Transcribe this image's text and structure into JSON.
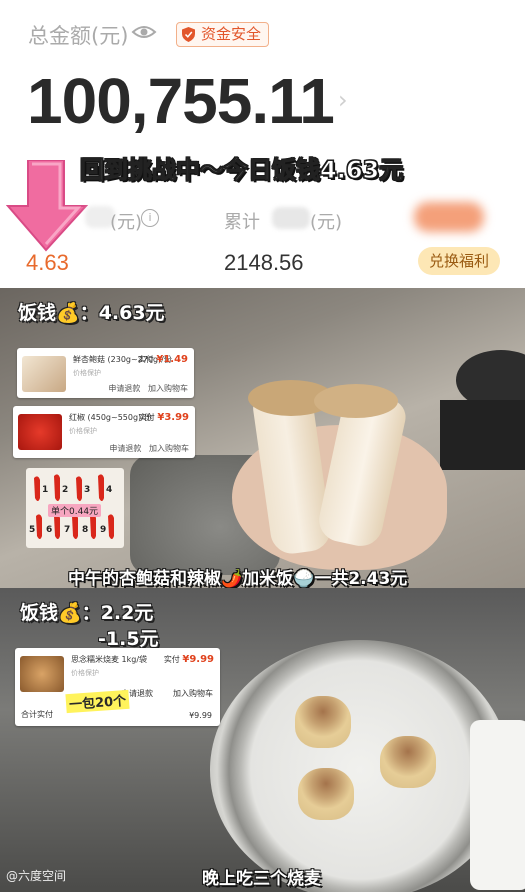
{
  "header": {
    "total_label": "总金额(元)",
    "badge": "资金安全",
    "amount": "100,755.11",
    "challenge_text": "回到挑战中～今日饭钱4.63元",
    "today_label": "(元)",
    "today_value": "4.63",
    "accum_label": "累计",
    "accum_unit": "(元)",
    "accum_value": "2148.56",
    "exchange_button": "兑换福利"
  },
  "panel1": {
    "cost_tag": "饭钱💰：4.63元",
    "cards": [
      {
        "name": "鲜杏鲍菇 (230g~270g)/份",
        "price_label": "实付",
        "price": "¥1.49",
        "sub": "价格保护",
        "actions": [
          "申请退款",
          "加入购物车"
        ]
      },
      {
        "name": "红椒 (450g~550g)/份",
        "price_label": "实付",
        "price": "¥3.99",
        "sub": "价格保护",
        "actions": [
          "申请退款",
          "加入购物车"
        ]
      }
    ],
    "pepper_caption": "单个0.44元",
    "pepper_numbers": [
      "1",
      "2",
      "3",
      "4",
      "5",
      "6",
      "7",
      "8",
      "9"
    ],
    "caption": "中午的杏鲍菇和辣椒🌶️加米饭🍚一共2.43元"
  },
  "panel2": {
    "cost_tag": "饭钱💰：2.2元",
    "discount": "-1.5元",
    "card": {
      "name": "思念糯米烧麦 1kg/袋",
      "price_label": "实付",
      "price": "¥9.99",
      "sub": "价格保护",
      "actions": [
        "申请退款",
        "加入购物车"
      ],
      "total_label": "合计实付",
      "total": "¥9.99"
    },
    "pack_note": "一包20个",
    "caption": "晚上吃三个烧麦",
    "watermark": "@六度空间"
  },
  "colors": {
    "accent": "#e86a2c",
    "badge": "#e2562b",
    "exchange_bg": "#fde7b5"
  }
}
